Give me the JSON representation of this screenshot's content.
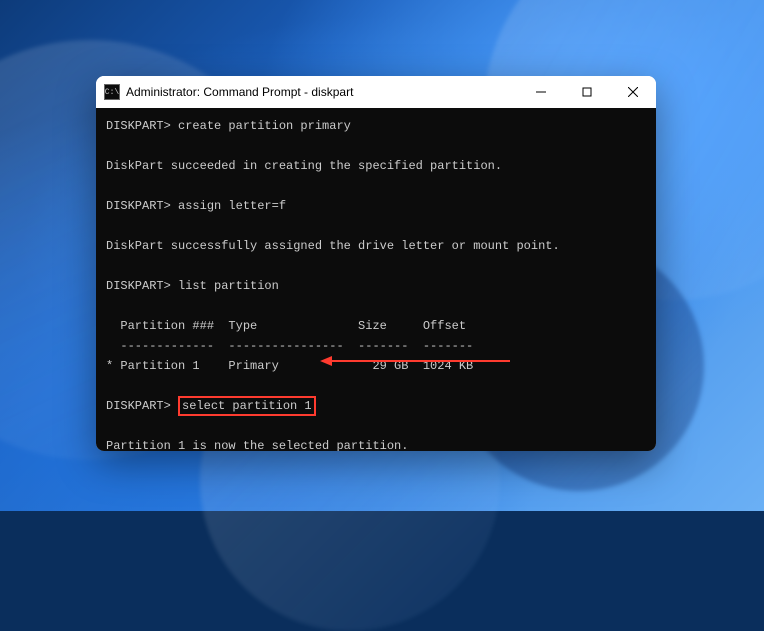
{
  "window": {
    "title": "Administrator: Command Prompt - diskpart"
  },
  "terminal": {
    "prompt": "DISKPART>",
    "cmd_create": "create partition primary",
    "resp_create": "DiskPart succeeded in creating the specified partition.",
    "cmd_assign": "assign letter=f",
    "resp_assign": "DiskPart successfully assigned the drive letter or mount point.",
    "cmd_list": "list partition",
    "table_header": "  Partition ###  Type              Size     Offset",
    "table_divider": "  -------------  ----------------  -------  -------",
    "table_row": "* Partition 1    Primary             29 GB  1024 KB",
    "cmd_select": "select partition 1",
    "resp_select": "Partition 1 is now the selected partition."
  }
}
